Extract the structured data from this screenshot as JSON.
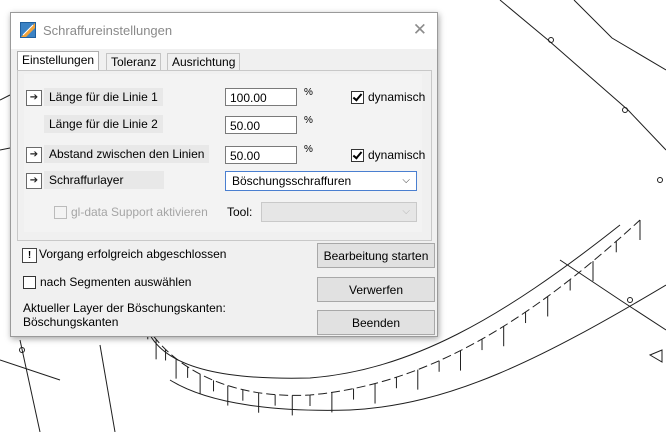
{
  "dialog": {
    "title": "Schraffureinstellungen",
    "close_glyph": "✕",
    "tabs": [
      "Einstellungen",
      "Toleranz",
      "Ausrichtung"
    ],
    "active_tab": "Einstellungen"
  },
  "settings": {
    "line1_label": "Länge für die Linie 1",
    "line1_value": "100.00",
    "line1_unit": "%",
    "line1_dynamic_label": "dynamisch",
    "line1_dynamic_checked": true,
    "line2_label": "Länge für die Linie 2",
    "line2_value": "50.00",
    "line2_unit": "%",
    "spacing_label": "Abstand zwischen den Linien",
    "spacing_value": "50.00",
    "spacing_unit": "%",
    "spacing_dynamic_label": "dynamisch",
    "spacing_dynamic_checked": true,
    "layer_label": "Schraffurlayer",
    "layer_value": "Böschungsschraffuren",
    "gl_support_label": "gl-data Support aktivieren",
    "tool_label": "Tool:"
  },
  "footer": {
    "status_icon": "!",
    "status_text": "Vorgang erfolgreich abgeschlossen",
    "segments_label": "nach Segmenten auswählen",
    "current_layer_heading": "Aktueller Layer der Böschungskanten:",
    "current_layer_value": "Böschungskanten",
    "start_button": "Bearbeitung starten",
    "discard_button": "Verwerfen",
    "exit_button": "Beenden"
  },
  "icons": {
    "arrow": "right-arrow-icon",
    "app": "hatch-settings-icon",
    "chevron": "chevron-down-icon"
  },
  "colors": {
    "combo_focus_border": "#4a7fd0",
    "cad_lines": "#1e1e1e"
  }
}
